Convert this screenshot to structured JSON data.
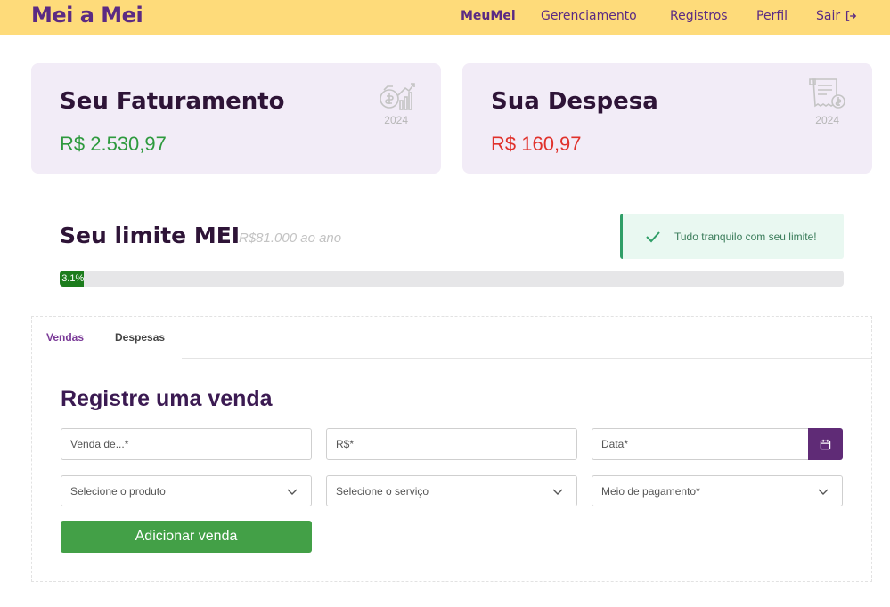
{
  "header": {
    "brand": "Mei a Mei",
    "nav": {
      "meumei": "MeuMei",
      "gerenciamento": "Gerenciamento",
      "registros": "Registros",
      "perfil": "Perfil",
      "sair": "Sair"
    },
    "bg_color": "#fedb7a",
    "accent_color": "#5b2a83"
  },
  "cards": {
    "faturamento": {
      "title": "Seu Faturamento",
      "value": "R$ 2.530,97",
      "year": "2024",
      "icon": "revenue-growth-icon",
      "color": "#2e9a3e"
    },
    "despesa": {
      "title": "Sua Despesa",
      "value": "R$ 160,97",
      "year": "2024",
      "icon": "receipt-icon",
      "color": "#e0312b"
    }
  },
  "limit": {
    "title": "Seu limite MEI",
    "subtitle": "R$81.000 ao ano",
    "progress_label": "3.1%",
    "progress_percent": 3.1,
    "alert": "Tudo tranquilo com seu limite!"
  },
  "tabs": {
    "vendas": "Vendas",
    "despesas": "Despesas",
    "active": "Vendas"
  },
  "form": {
    "title": "Registre uma venda",
    "venda_placeholder": "Venda de...*",
    "valor_placeholder": "R$*",
    "data_placeholder": "Data*",
    "produto_select": "Selecione o produto",
    "servico_select": "Selecione o serviço",
    "pagamento_select": "Meio de pagamento*",
    "submit": "Adicionar venda"
  }
}
